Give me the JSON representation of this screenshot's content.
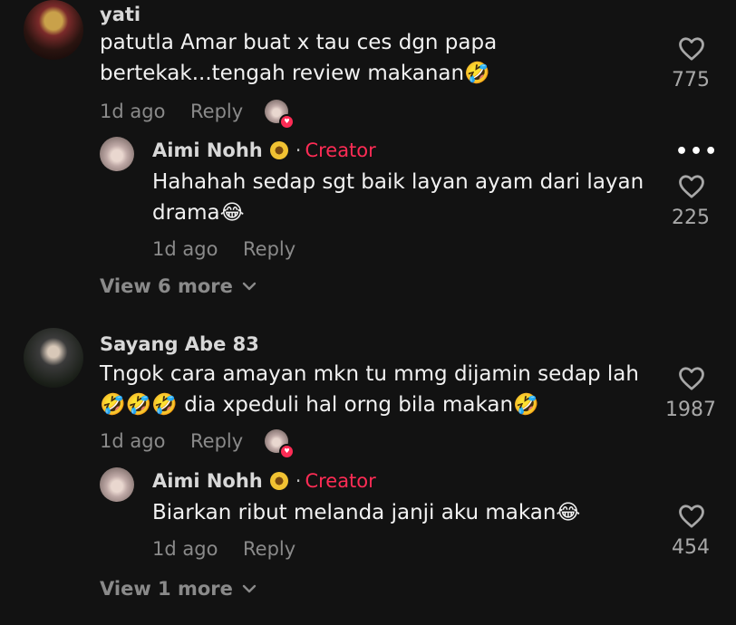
{
  "comments": [
    {
      "username": "yati",
      "text_line1": "patutla Amar buat x tau ces dgn papa",
      "text_line2": "bertekak...tengah review makanan🤣",
      "time": "1d ago",
      "reply_label": "Reply",
      "likes": "775",
      "reply": {
        "username": "Aimi Nohh",
        "badge": "Creator",
        "separator": "·",
        "text_line1": "Hahahah sedap sgt baik layan ayam dari layan",
        "text_line2": "drama😂",
        "time": "1d ago",
        "reply_label": "Reply",
        "likes": "225",
        "more_icon": "•••"
      },
      "view_more": "View 6 more"
    },
    {
      "username": "Sayang Abe 83",
      "text_line1": "Tngok cara amayan mkn tu mmg dijamin sedap lah",
      "text_line2": "🤣🤣🤣 dia xpeduli hal orng bila makan🤣",
      "time": "1d ago",
      "reply_label": "Reply",
      "likes": "1987",
      "reply": {
        "username": "Aimi Nohh",
        "badge": "Creator",
        "separator": "·",
        "text_line1": "Biarkan ribut melanda janji aku makan😂",
        "time": "1d ago",
        "reply_label": "Reply",
        "likes": "454"
      },
      "view_more": "View 1 more"
    }
  ],
  "colors": {
    "background": "#121212",
    "creator_accent": "#fe2c55",
    "muted_text": "#8a8a8a"
  },
  "icons": {
    "like": "heart-outline-icon",
    "expand": "chevron-down-icon",
    "more": "ellipsis-icon",
    "creator_liked": "heart-badge-icon"
  }
}
